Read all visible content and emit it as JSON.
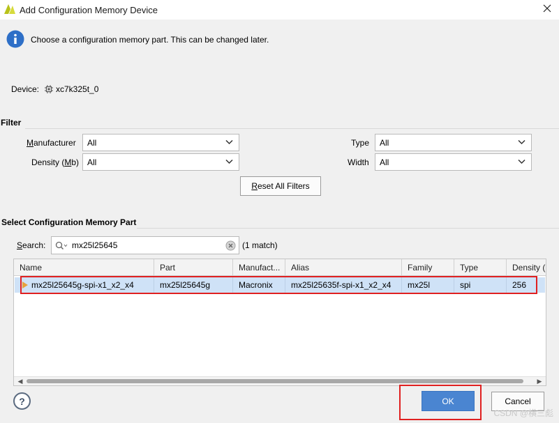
{
  "window": {
    "title": "Add Configuration Memory Device",
    "close_icon": "close-icon"
  },
  "info": {
    "icon": "info-icon",
    "text": "Choose a configuration memory part. This can be changed later."
  },
  "device": {
    "label": "Device:",
    "icon": "chip-icon",
    "value": "xc7k325t_0"
  },
  "filter": {
    "section_title": "Filter",
    "manufacturer": {
      "label_pre": "",
      "label_mn": "M",
      "label_post": "anufacturer",
      "value": "All"
    },
    "density": {
      "label_pre": "Density (",
      "label_mn": "M",
      "label_post": "b)",
      "value": "All"
    },
    "type": {
      "label": "Type",
      "value": "All"
    },
    "width": {
      "label": "Width",
      "value": "All"
    },
    "reset_button": {
      "mn": "R",
      "rest": "eset All Filters"
    }
  },
  "part_select": {
    "section_title": "Select Configuration Memory Part",
    "search_label_mn": "S",
    "search_label_rest": "earch:",
    "search_value": "mx25l25645",
    "match_text": "(1 match)",
    "columns": [
      "Name",
      "Part",
      "Manufact...",
      "Alias",
      "Family",
      "Type",
      "Density (..."
    ],
    "rows": [
      {
        "name": "mx25l25645g-spi-x1_x2_x4",
        "part": "mx25l25645g",
        "manufacturer": "Macronix",
        "alias": "mx25l25635f-spi-x1_x2_x4",
        "family": "mx25l",
        "type": "spi",
        "density": "256"
      }
    ]
  },
  "footer": {
    "help": "?",
    "ok": "OK",
    "cancel": "Cancel",
    "watermark": "CSDN @横三彪"
  },
  "colors": {
    "accent": "#4a85d1",
    "selection": "#cfe2f7",
    "highlight": "#e02020"
  }
}
